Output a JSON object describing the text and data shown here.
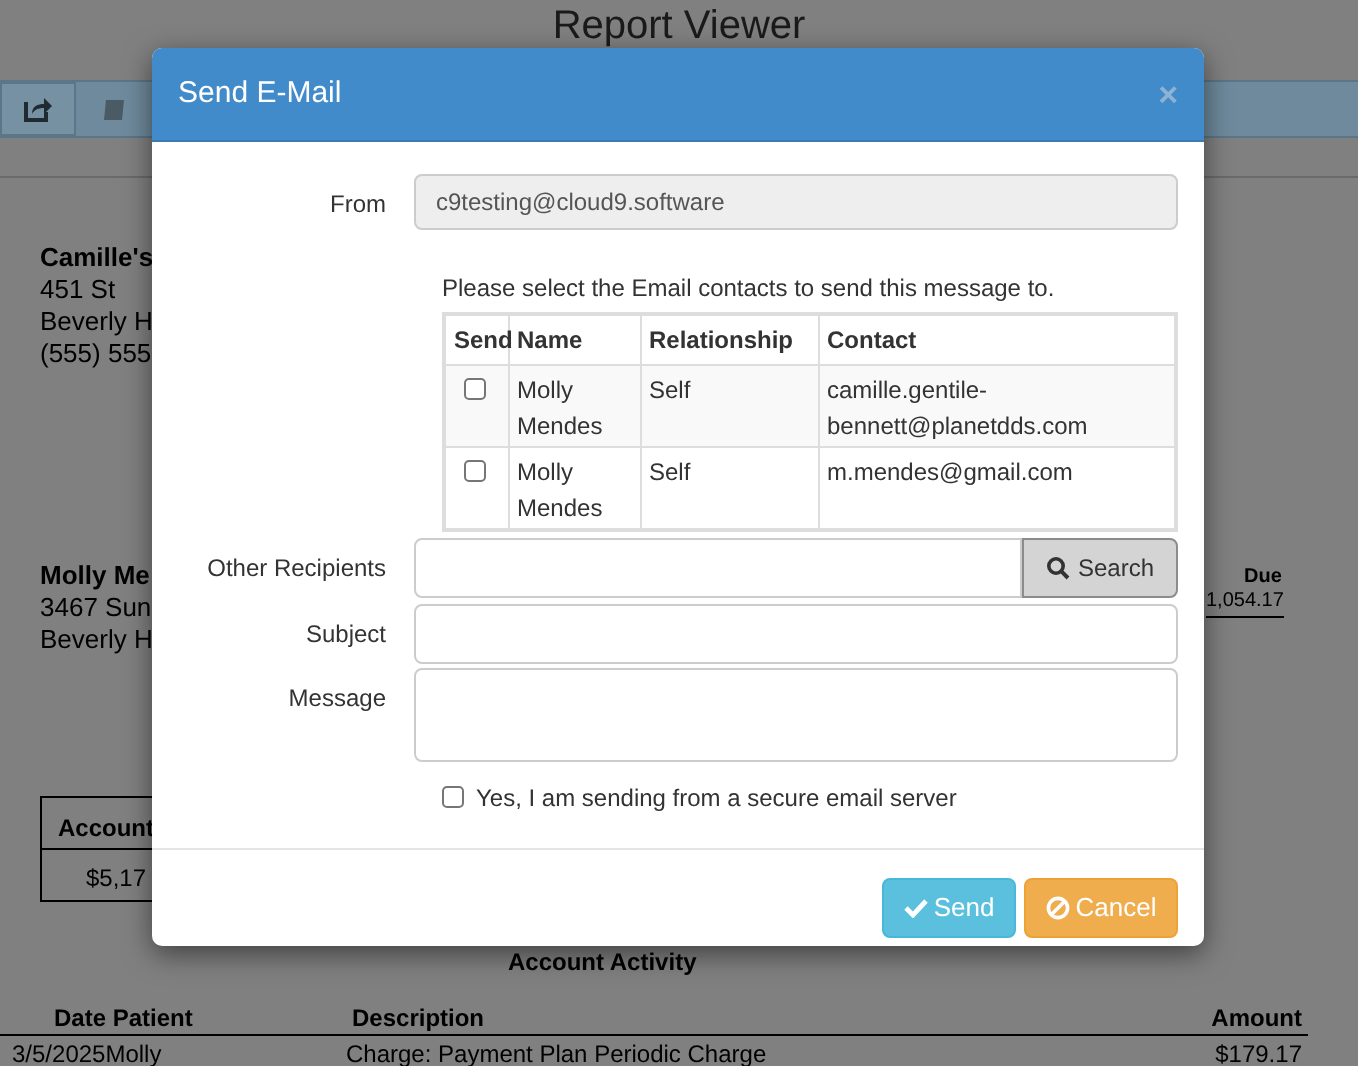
{
  "report": {
    "title": "Report Viewer",
    "practice": {
      "name": "Camille's",
      "lines": [
        "451 St",
        "Beverly H",
        "(555) 555"
      ]
    },
    "patient": {
      "name": "Molly Me",
      "lines": [
        "3467 Sun",
        "Beverly H"
      ]
    },
    "due": {
      "label": "Due",
      "value": "1,054.17"
    },
    "account_box": {
      "header": "Account",
      "value": "$5,17"
    },
    "activity": {
      "title": "Account Activity",
      "columns": [
        "Date Patient",
        "Description",
        "Amount"
      ],
      "rows": [
        {
          "cells": [
            "3/5/2025Molly",
            "Charge: Payment Plan Periodic Charge",
            "$179.17"
          ]
        }
      ]
    }
  },
  "dialog": {
    "title": "Send E-Mail",
    "close": "×",
    "from": {
      "label": "From",
      "value": "c9testing@cloud9.software"
    },
    "instructions": "Please select the Email contacts to send this message to.",
    "contacts": {
      "columns": [
        "Send",
        "Name",
        "Relationship",
        "Contact"
      ],
      "rows": [
        {
          "checked": false,
          "name": "Molly Mendes",
          "relationship": "Self",
          "contact": "camille.gentile-bennett@planetdds.com"
        },
        {
          "checked": false,
          "name": "Molly Mendes",
          "relationship": "Self",
          "contact": "m.mendes@gmail.com"
        }
      ]
    },
    "other_recipients": {
      "label": "Other Recipients",
      "search_button": "Search"
    },
    "subject": {
      "label": "Subject"
    },
    "message": {
      "label": "Message"
    },
    "secure": {
      "label": "Yes, I am sending from a secure email server",
      "checked": false
    },
    "buttons": [
      {
        "kind": "send",
        "label": "Send"
      },
      {
        "kind": "cancel",
        "label": "Cancel"
      }
    ]
  }
}
